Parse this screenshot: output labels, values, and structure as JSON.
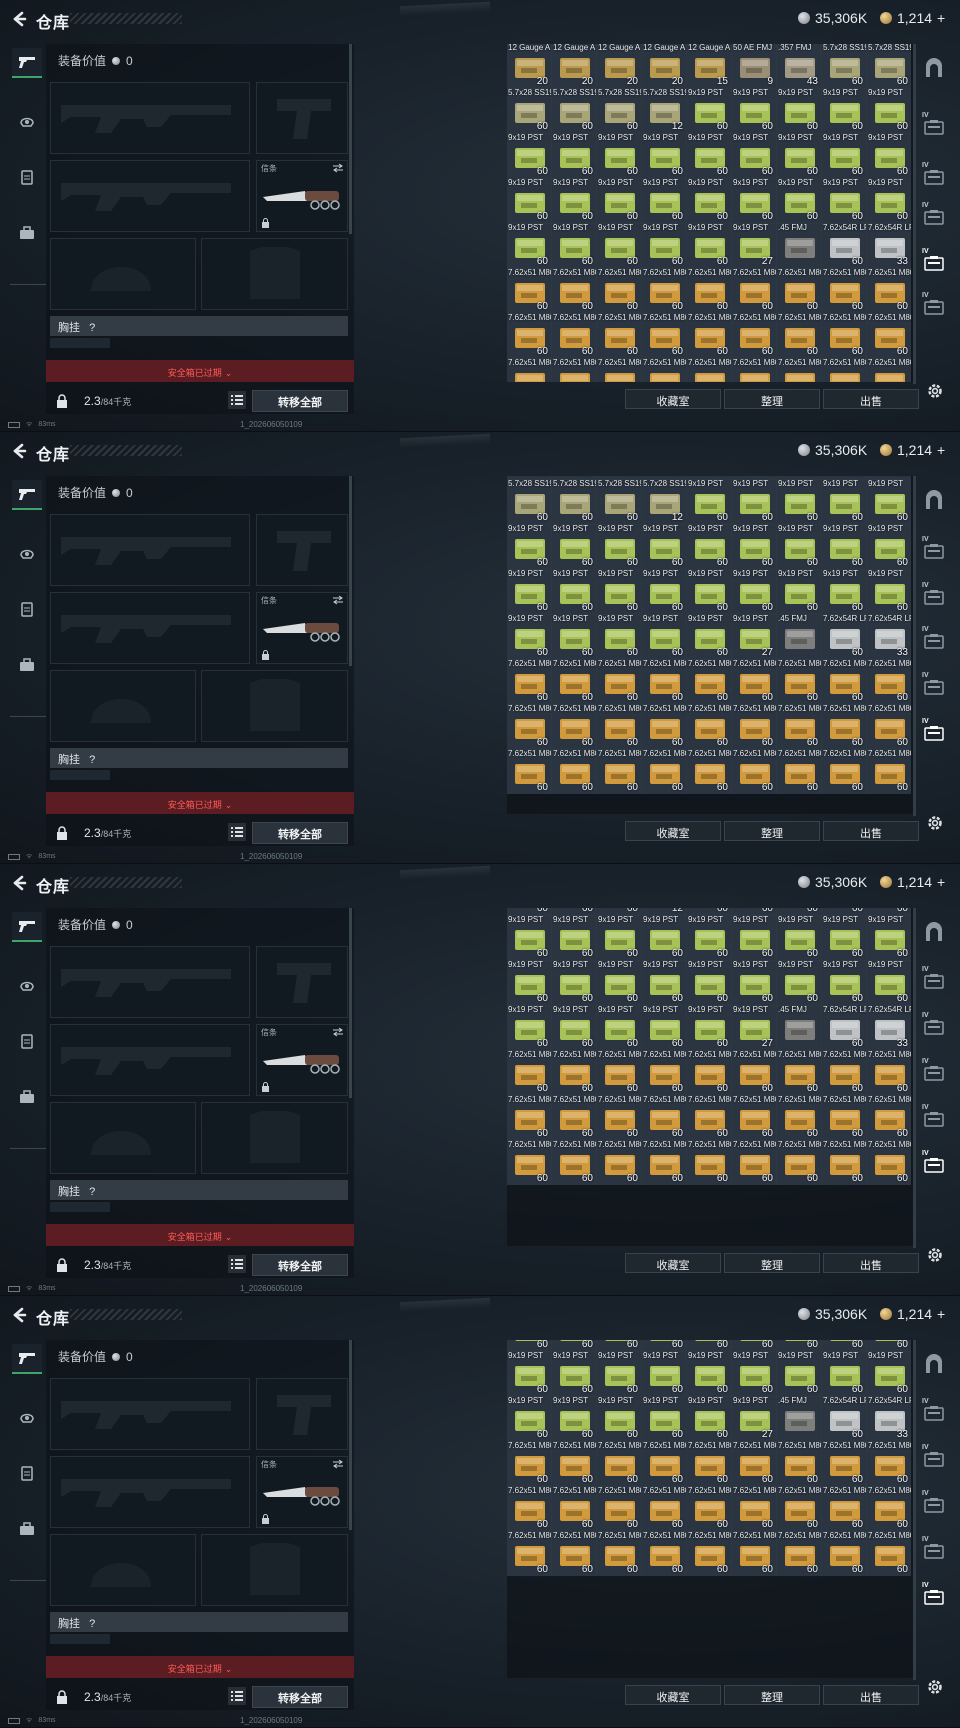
{
  "header": {
    "title": "仓库",
    "currency_a": "35,306K",
    "currency_b": "1,214",
    "currency_b_plus": "+"
  },
  "equipment": {
    "value_label": "装备价值",
    "value_amount": "0",
    "knife_label": "信条",
    "chest_rig_label": "胸挂",
    "chest_rig_value": "?",
    "safebox_label": "安全箱已过期",
    "weight_value": "2.3",
    "weight_capacity": "/84千克",
    "transfer_label": "转移全部"
  },
  "status": {
    "ping": "83ms",
    "build": "1_202606050109"
  },
  "grid_buttons": {
    "favorites": "收藏室",
    "sort": "整理",
    "sell": "出售"
  },
  "right_bar": {
    "levels": [
      "IV",
      "IV",
      "IV",
      "IV",
      "IV",
      "IV"
    ]
  },
  "frames": [
    {
      "scroll_label": "top"
    },
    {
      "scroll_label": "mid"
    },
    {
      "scroll_label": "mid2"
    },
    {
      "scroll_label": "low"
    }
  ],
  "inventory": {
    "rows": [
      [
        {
          "name": "12 Gauge A...",
          "count": "20",
          "kind": "gauge"
        },
        {
          "name": "12 Gauge A...",
          "count": "20",
          "kind": "gauge"
        },
        {
          "name": "12 Gauge A...",
          "count": "20",
          "kind": "gauge"
        },
        {
          "name": "12 Gauge A...",
          "count": "20",
          "kind": "gauge"
        },
        {
          "name": "12 Gauge A...",
          "count": "15",
          "kind": "gauge"
        },
        {
          "name": "50 AE FMJ",
          "count": "9",
          "kind": "ae"
        },
        {
          "name": ".357 FMJ",
          "count": "43",
          "kind": "357"
        },
        {
          "name": "5.7x28 SS190",
          "count": "60",
          "kind": "57"
        },
        {
          "name": "5.7x28 SS190",
          "count": "60",
          "kind": "57"
        }
      ],
      [
        {
          "name": "5.7x28 SS190",
          "count": "60",
          "kind": "57"
        },
        {
          "name": "5.7x28 SS190",
          "count": "60",
          "kind": "57"
        },
        {
          "name": "5.7x28 SS190",
          "count": "60",
          "kind": "57"
        },
        {
          "name": "5.7x28 SS190",
          "count": "12",
          "kind": "57"
        },
        {
          "name": "9x19 PST",
          "count": "60",
          "kind": "919"
        },
        {
          "name": "9x19 PST",
          "count": "60",
          "kind": "919"
        },
        {
          "name": "9x19 PST",
          "count": "60",
          "kind": "919"
        },
        {
          "name": "9x19 PST",
          "count": "60",
          "kind": "919"
        },
        {
          "name": "9x19 PST",
          "count": "60",
          "kind": "919"
        }
      ],
      [
        {
          "name": "9x19 PST",
          "count": "60",
          "kind": "919"
        },
        {
          "name": "9x19 PST",
          "count": "60",
          "kind": "919"
        },
        {
          "name": "9x19 PST",
          "count": "60",
          "kind": "919"
        },
        {
          "name": "9x19 PST",
          "count": "60",
          "kind": "919"
        },
        {
          "name": "9x19 PST",
          "count": "60",
          "kind": "919"
        },
        {
          "name": "9x19 PST",
          "count": "60",
          "kind": "919"
        },
        {
          "name": "9x19 PST",
          "count": "60",
          "kind": "919"
        },
        {
          "name": "9x19 PST",
          "count": "60",
          "kind": "919"
        },
        {
          "name": "9x19 PST",
          "count": "60",
          "kind": "919"
        }
      ],
      [
        {
          "name": "9x19 PST",
          "count": "60",
          "kind": "919"
        },
        {
          "name": "9x19 PST",
          "count": "60",
          "kind": "919"
        },
        {
          "name": "9x19 PST",
          "count": "60",
          "kind": "919"
        },
        {
          "name": "9x19 PST",
          "count": "60",
          "kind": "919"
        },
        {
          "name": "9x19 PST",
          "count": "60",
          "kind": "919"
        },
        {
          "name": "9x19 PST",
          "count": "60",
          "kind": "919"
        },
        {
          "name": "9x19 PST",
          "count": "60",
          "kind": "919"
        },
        {
          "name": "9x19 PST",
          "count": "60",
          "kind": "919"
        },
        {
          "name": "9x19 PST",
          "count": "60",
          "kind": "919"
        }
      ],
      [
        {
          "name": "9x19 PST",
          "count": "60",
          "kind": "919"
        },
        {
          "name": "9x19 PST",
          "count": "60",
          "kind": "919"
        },
        {
          "name": "9x19 PST",
          "count": "60",
          "kind": "919"
        },
        {
          "name": "9x19 PST",
          "count": "60",
          "kind": "919"
        },
        {
          "name": "9x19 PST",
          "count": "60",
          "kind": "919"
        },
        {
          "name": "9x19 PST",
          "count": "27",
          "kind": "919"
        },
        {
          "name": ".45 FMJ",
          "count": "",
          "kind": "45"
        },
        {
          "name": "7.62x54R LPS",
          "count": "60",
          "kind": "762r"
        },
        {
          "name": "7.62x54R LPS",
          "count": "33",
          "kind": "762r"
        }
      ],
      [
        {
          "name": "7.62x51 M80",
          "count": "60",
          "kind": "762n"
        },
        {
          "name": "7.62x51 M80",
          "count": "60",
          "kind": "762n"
        },
        {
          "name": "7.62x51 M80",
          "count": "60",
          "kind": "762n"
        },
        {
          "name": "7.62x51 M80",
          "count": "60",
          "kind": "762n"
        },
        {
          "name": "7.62x51 M80",
          "count": "60",
          "kind": "762n"
        },
        {
          "name": "7.62x51 M80",
          "count": "60",
          "kind": "762n"
        },
        {
          "name": "7.62x51 M80",
          "count": "60",
          "kind": "762n"
        },
        {
          "name": "7.62x51 M80",
          "count": "60",
          "kind": "762n"
        },
        {
          "name": "7.62x51 M80",
          "count": "60",
          "kind": "762n"
        }
      ],
      [
        {
          "name": "7.62x51 M80",
          "count": "60",
          "kind": "762n"
        },
        {
          "name": "7.62x51 M80",
          "count": "60",
          "kind": "762n"
        },
        {
          "name": "7.62x51 M80",
          "count": "60",
          "kind": "762n"
        },
        {
          "name": "7.62x51 M80",
          "count": "60",
          "kind": "762n"
        },
        {
          "name": "7.62x51 M80",
          "count": "60",
          "kind": "762n"
        },
        {
          "name": "7.62x51 M80",
          "count": "60",
          "kind": "762n"
        },
        {
          "name": "7.62x51 M80",
          "count": "60",
          "kind": "762n"
        },
        {
          "name": "7.62x51 M80",
          "count": "60",
          "kind": "762n"
        },
        {
          "name": "7.62x51 M80",
          "count": "60",
          "kind": "762n"
        }
      ],
      [
        {
          "name": "7.62x51 M80",
          "count": "60",
          "kind": "762n"
        },
        {
          "name": "7.62x51 M80",
          "count": "60",
          "kind": "762n"
        },
        {
          "name": "7.62x51 M80",
          "count": "60",
          "kind": "762n"
        },
        {
          "name": "7.62x51 M80",
          "count": "60",
          "kind": "762n"
        },
        {
          "name": "7.62x51 M80",
          "count": "60",
          "kind": "762n"
        },
        {
          "name": "7.62x51 M80",
          "count": "60",
          "kind": "762n"
        },
        {
          "name": "7.62x51 M80",
          "count": "60",
          "kind": "762n"
        },
        {
          "name": "7.62x51 M80",
          "count": "60",
          "kind": "762n"
        },
        {
          "name": "7.62x51 M80",
          "count": "60",
          "kind": "762n"
        }
      ]
    ]
  }
}
